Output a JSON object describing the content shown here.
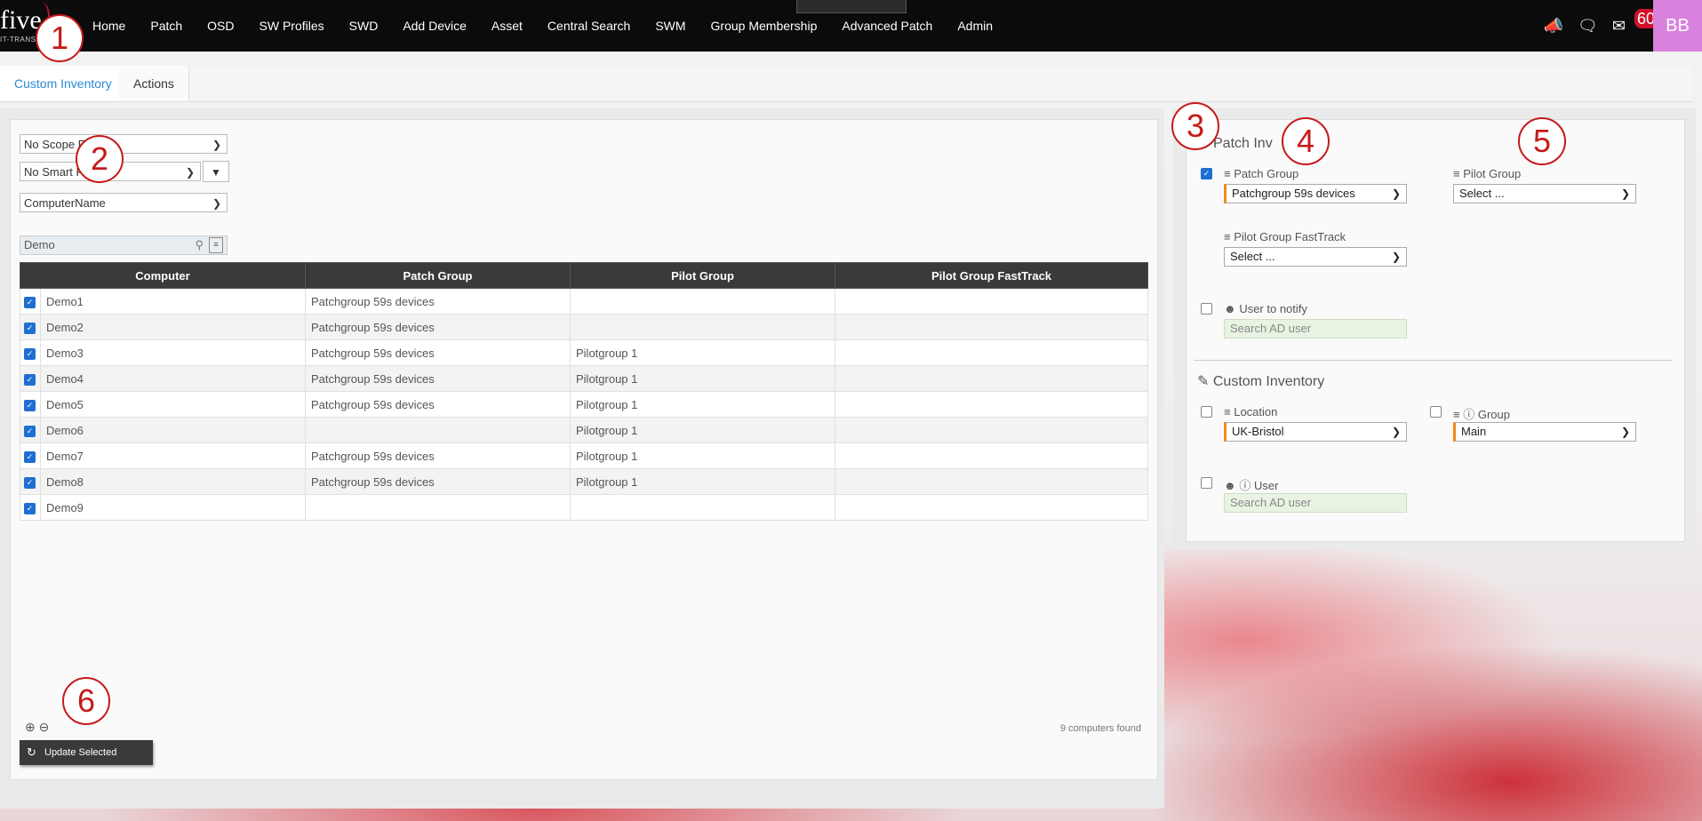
{
  "logo": {
    "name": "five",
    "sub": "IT-TRANS"
  },
  "nav": [
    "Home",
    "Patch",
    "OSD",
    "SW Profiles",
    "SWD",
    "Add Device",
    "Asset",
    "Central Search",
    "SWM",
    "Group Membership",
    "Advanced Patch",
    "Admin"
  ],
  "header": {
    "mail_badge": "60",
    "avatar": "BB"
  },
  "tabs": [
    "Custom Inventory",
    "Actions"
  ],
  "filters": {
    "scope": "No Scope F",
    "smart": "No Smart F",
    "column": "ComputerName",
    "search_value": "Demo"
  },
  "table": {
    "headers": [
      "Computer",
      "Patch Group",
      "Pilot Group",
      "Pilot Group FastTrack"
    ],
    "rows": [
      [
        "Demo1",
        "Patchgroup 59s devices",
        "",
        ""
      ],
      [
        "Demo2",
        "Patchgroup 59s devices",
        "",
        ""
      ],
      [
        "Demo3",
        "Patchgroup 59s devices",
        "Pilotgroup 1",
        ""
      ],
      [
        "Demo4",
        "Patchgroup 59s devices",
        "Pilotgroup 1",
        ""
      ],
      [
        "Demo5",
        "Patchgroup 59s devices",
        "Pilotgroup 1",
        ""
      ],
      [
        "Demo6",
        "",
        "Pilotgroup 1",
        ""
      ],
      [
        "Demo7",
        "Patchgroup 59s devices",
        "Pilotgroup 1",
        ""
      ],
      [
        "Demo8",
        "Patchgroup 59s devices",
        "Pilotgroup 1",
        ""
      ],
      [
        "Demo9",
        "",
        "",
        ""
      ]
    ]
  },
  "footer": {
    "count": "9 computers found",
    "update_label": "Update Selected"
  },
  "patch_inventory": {
    "title": "Patch Inv",
    "patch_group_label": "Patch Group",
    "patch_group_value": "Patchgroup 59s devices",
    "pilot_group_label": "Pilot Group",
    "pilot_group_value": "Select ...",
    "fasttrack_label": "Pilot Group FastTrack",
    "fasttrack_value": "Select ...",
    "user_notify_label": "User to notify",
    "user_notify_placeholder": "Search AD user"
  },
  "custom_inventory": {
    "title": "Custom Inventory",
    "location_label": "Location",
    "location_value": "UK-Bristol",
    "group_label": "Group",
    "group_value": "Main",
    "user_label": "User",
    "user_placeholder": "Search AD user"
  },
  "markers": [
    "1",
    "2",
    "3",
    "4",
    "5",
    "6"
  ]
}
